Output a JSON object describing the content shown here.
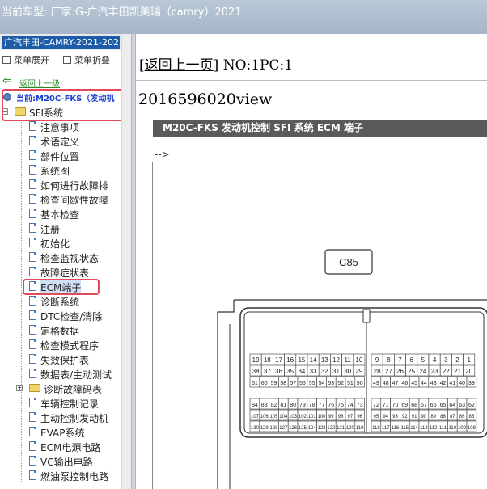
{
  "window": {
    "title": "当前车型:  厂家:G-广汽丰田凯美瑞（camry）2021"
  },
  "sidebar": {
    "tab_title": "广汽丰田-CAMRY-2021-202",
    "toolbar": {
      "expand": "菜单展开",
      "collapse": "菜单折叠"
    },
    "back_link": "返回上一级",
    "current_label": "当前:M20C-FKS（发动机",
    "root_folder": "SFI系统",
    "items": [
      "注意事项",
      "术语定义",
      "部件位置",
      "系统图",
      "如何进行故障排",
      "检查间歇性故障",
      "基本检查",
      "注册",
      "初始化",
      "检查监视状态",
      "故障症状表",
      "ECM端子",
      "诊断系统",
      "DTC检查/清除",
      "定格数据",
      "检查模式程序",
      "失效保护表",
      "数据表/主动测试"
    ],
    "subfolder": "诊断故障码表",
    "items2": [
      "车辆控制记录",
      "主动控制发动机",
      "EVAP系统",
      "ECM电源电路",
      "VC输出电路",
      "燃油泵控制电路"
    ]
  },
  "main": {
    "back_label": "返回上一页",
    "page_no": "NO:1PC:1",
    "view_title": "2016596020view",
    "section_header": "M20C-FKS 发动机控制  SFI 系统  ECM 端子",
    "arrow_text": "-->",
    "connector_label": "C85",
    "pins_row1": [
      "19",
      "18",
      "17",
      "16",
      "15",
      "14",
      "13",
      "12",
      "11",
      "10",
      "9",
      "8",
      "7",
      "6",
      "5",
      "4",
      "3",
      "2",
      "1"
    ],
    "pins_row2": [
      "38",
      "37",
      "36",
      "35",
      "34",
      "33",
      "32",
      "31",
      "30",
      "29",
      "28",
      "27",
      "26",
      "25",
      "24",
      "23",
      "22",
      "21",
      "20"
    ],
    "pins_row3": [
      "61",
      "60",
      "59",
      "58",
      "57",
      "56",
      "55",
      "54",
      "53",
      "52",
      "51",
      "50",
      "49",
      "48",
      "47",
      "46",
      "45",
      "44",
      "43",
      "42",
      "41",
      "40",
      "39"
    ],
    "pins_row4": [
      "84",
      "83",
      "82",
      "81",
      "80",
      "79",
      "78",
      "77",
      "76",
      "75",
      "74",
      "73",
      "72",
      "71",
      "70",
      "69",
      "68",
      "67",
      "66",
      "65",
      "64",
      "63",
      "62"
    ],
    "pins_row5": [
      "107",
      "106",
      "105",
      "104",
      "103",
      "102",
      "101",
      "100",
      "99",
      "98",
      "97",
      "96",
      "95",
      "94",
      "93",
      "92",
      "91",
      "90",
      "89",
      "88",
      "87",
      "86",
      "85"
    ],
    "pins_row6": [
      "130",
      "129",
      "128",
      "127",
      "126",
      "125",
      "124",
      "123",
      "122",
      "121",
      "120",
      "119",
      "118",
      "117",
      "116",
      "115",
      "114",
      "113",
      "112",
      "111",
      "110",
      "109",
      "108"
    ]
  }
}
